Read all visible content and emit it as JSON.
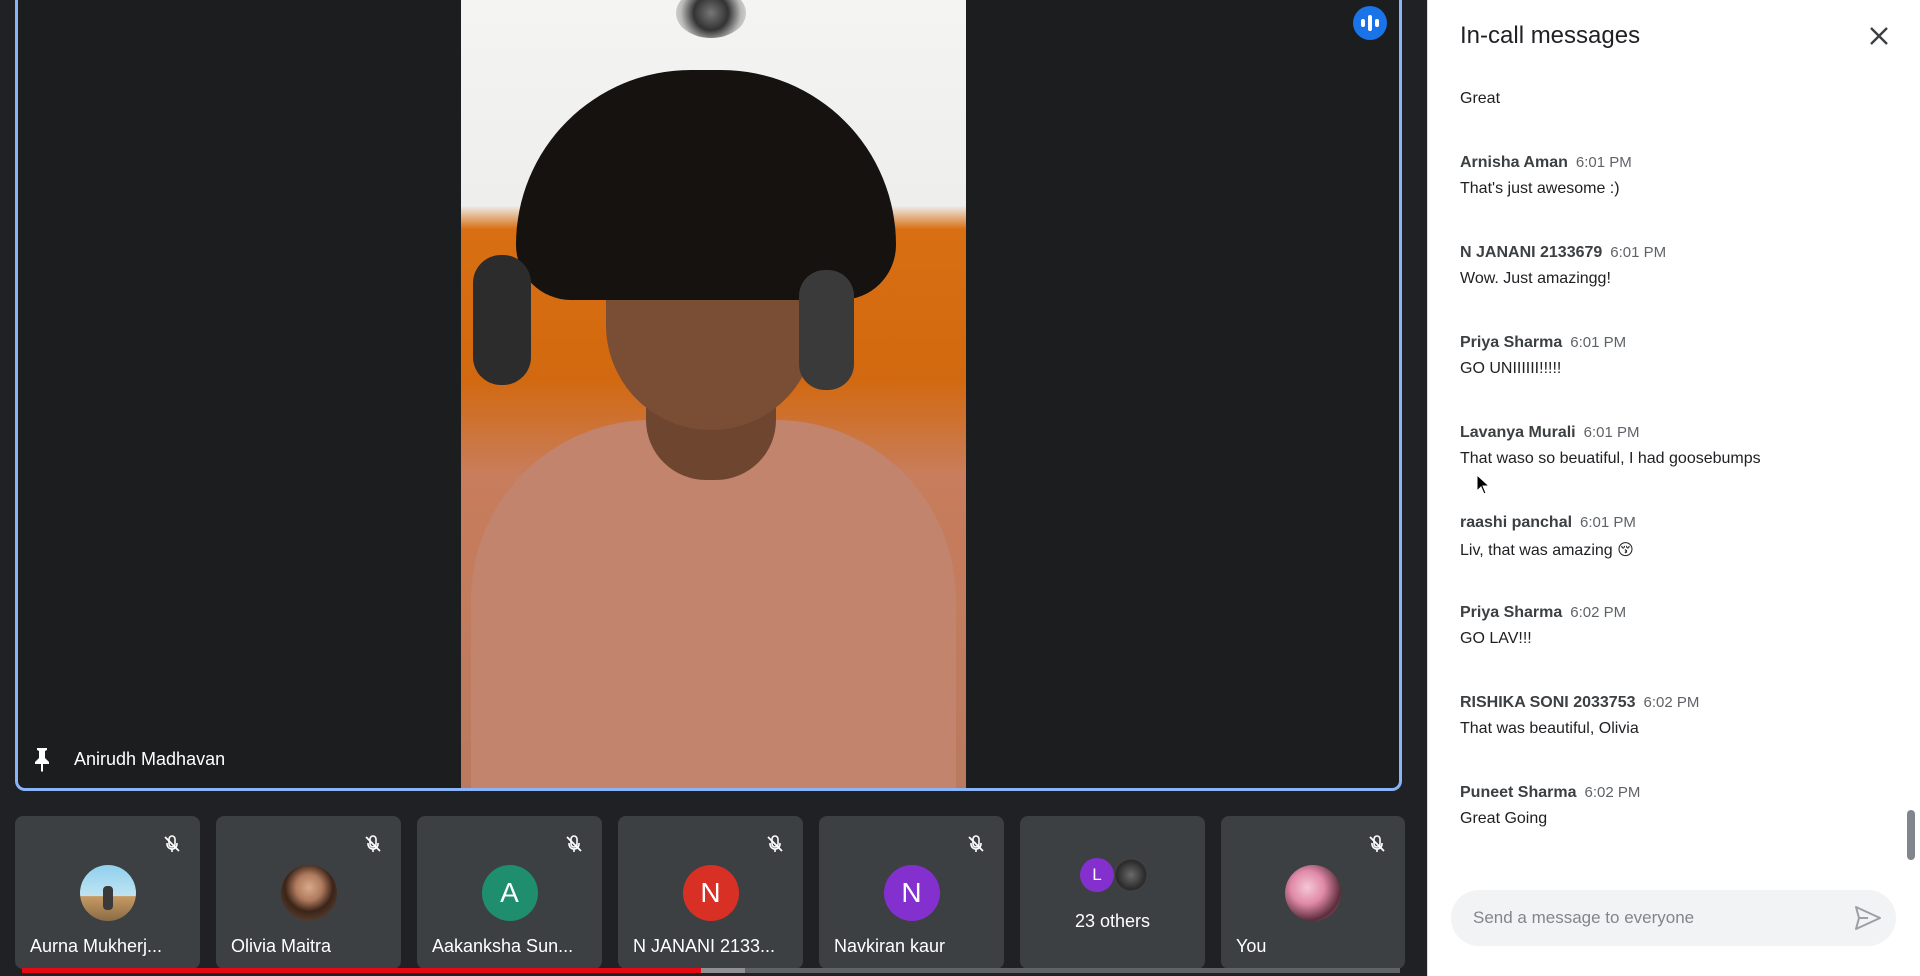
{
  "main_tile": {
    "participant_name": "Anirudh Madhavan",
    "speaking_icon": "audio-bars-icon",
    "pin_icon": "pin-icon"
  },
  "thumbnails": [
    {
      "name": "Aurna Mukherj...",
      "avatar": "photo",
      "muted": true
    },
    {
      "name": "Olivia Maitra",
      "avatar": "photo",
      "muted": true
    },
    {
      "name": "Aakanksha Sun...",
      "avatar_letter": "A",
      "avatar_color": "#1e8e6e",
      "muted": true
    },
    {
      "name": "N JANANI 2133...",
      "avatar_letter": "N",
      "avatar_color": "#d93025",
      "muted": true
    },
    {
      "name": "Navkiran kaur",
      "avatar_letter": "N",
      "avatar_color": "#8430ce",
      "muted": true
    },
    {
      "name": "23 others",
      "avatar_letter": "L",
      "avatar_color": "#8430ce"
    },
    {
      "name": "You",
      "avatar": "photo",
      "muted": true
    }
  ],
  "video_progress": {
    "played_fraction": 0.493,
    "buffered_fraction": 0.032
  },
  "chat": {
    "title": "In-call messages",
    "close_icon": "close-icon",
    "messages": [
      {
        "sender": "",
        "time": "",
        "text": "Great"
      },
      {
        "sender": "Arnisha Aman",
        "time": "6:01 PM",
        "text": "That's just awesome :)"
      },
      {
        "sender": "N JANANI 2133679",
        "time": "6:01 PM",
        "text": "Wow. Just amazingg!"
      },
      {
        "sender": "Priya Sharma",
        "time": "6:01 PM",
        "text": "GO UNIIIIII!!!!!"
      },
      {
        "sender": "Lavanya Murali",
        "time": "6:01 PM",
        "text": "That waso so beuatiful, I had goosebumps"
      },
      {
        "sender": "raashi panchal",
        "time": "6:01 PM",
        "text": "Liv, that was amazing 😚"
      },
      {
        "sender": "Priya Sharma",
        "time": "6:02 PM",
        "text": "GO LAV!!!"
      },
      {
        "sender": "RISHIKA SONI 2033753",
        "time": "6:02 PM",
        "text": "That was beautiful, Olivia"
      },
      {
        "sender": "Puneet Sharma",
        "time": "6:02 PM",
        "text": "Great Going"
      }
    ],
    "input_placeholder": "Send a message to everyone",
    "send_icon": "send-icon"
  }
}
